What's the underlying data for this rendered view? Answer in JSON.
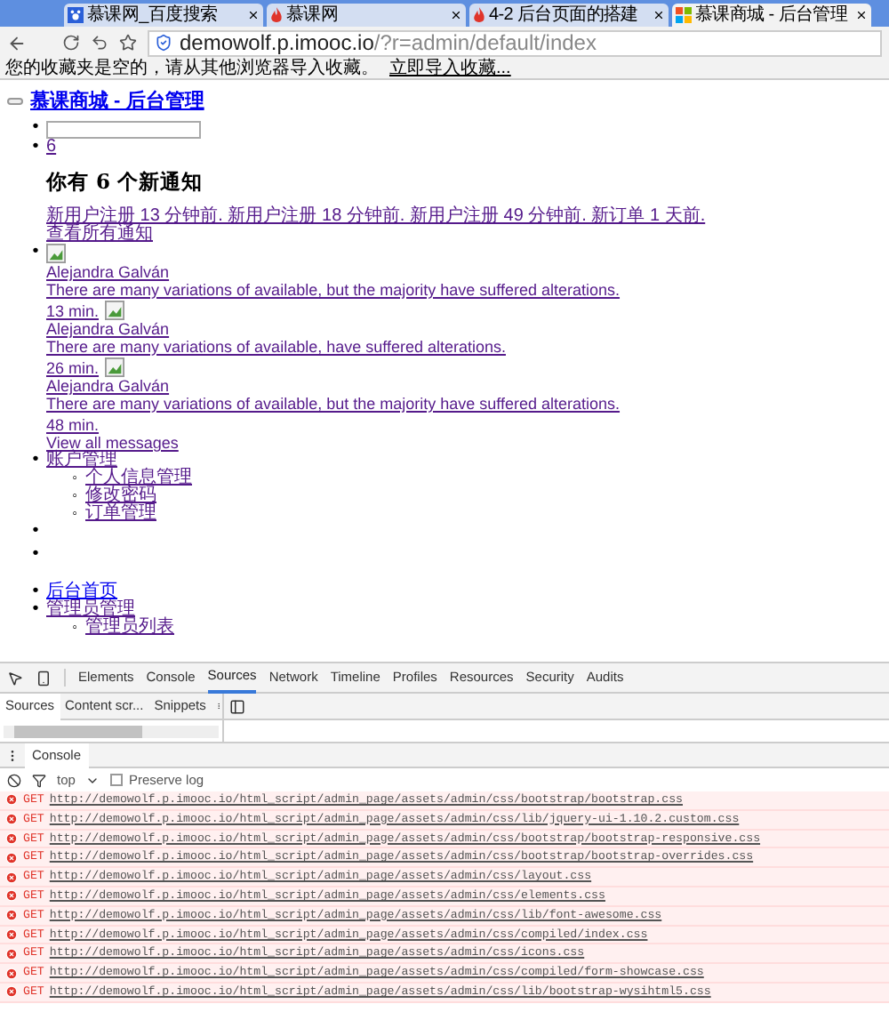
{
  "browser": {
    "tabs": [
      {
        "title": "慕课网_百度搜索",
        "selected": false,
        "kind": "paw"
      },
      {
        "title": "慕课网",
        "selected": false,
        "kind": "flame"
      },
      {
        "title": "4-2 后台页面的搭建",
        "selected": false,
        "kind": "flame"
      },
      {
        "title": "慕课商城 - 后台管理",
        "selected": true,
        "kind": "grid"
      }
    ],
    "address": {
      "host": "demowolf.p.imooc.io",
      "path": "/?r=admin/default/index"
    },
    "bookmarks_bar": {
      "message": "您的收藏夹是空的，请从其他浏览器导入收藏。",
      "link": "立即导入收藏..."
    }
  },
  "page": {
    "brand": "慕课商城 - 后台管理",
    "menu_items": [
      {
        "kind": "search",
        "marker": "•"
      },
      {
        "kind": "notifications",
        "marker": "•",
        "count": "6",
        "heading": "你有 6 个新通知",
        "notifications": "新用户注册 13 分钟前. 新用户注册 18 分钟前. 新用户注册 49 分钟前. 新订单 1 天前.",
        "view_all": "查看所有通知"
      },
      {
        "kind": "messages",
        "marker": "•",
        "messages": [
          {
            "name": "Alejandra Galván",
            "text": "There are many variations of available, but the majority have suffered alterations.",
            "time": "13 min."
          },
          {
            "name": "Alejandra Galván",
            "text": "There are many variations of available, have suffered alterations.",
            "time": "26 min."
          },
          {
            "name": "Alejandra Galván",
            "text": "There are many variations of available, but the majority have suffered alterations.",
            "time": "48 min."
          }
        ],
        "view_all": "View all messages"
      },
      {
        "kind": "menu",
        "marker": "•",
        "label": "账户管理",
        "children": [
          {
            "marker": "◦",
            "label": "个人信息管理"
          },
          {
            "marker": "◦",
            "label": "修改密码"
          },
          {
            "marker": "◦",
            "label": "订单管理"
          }
        ]
      },
      {
        "kind": "empty",
        "marker": "•"
      },
      {
        "kind": "empty",
        "marker": "•"
      }
    ],
    "nav": [
      {
        "marker": "•",
        "label": "后台首页",
        "visited": false
      },
      {
        "marker": "•",
        "label": "管理员管理",
        "visited": true,
        "children": [
          {
            "marker": "◦",
            "label": "管理员列表"
          }
        ]
      }
    ]
  },
  "devtools": {
    "tabs": [
      {
        "label": "Elements",
        "selected": false
      },
      {
        "label": "Console",
        "selected": false
      },
      {
        "label": "Sources",
        "selected": true
      },
      {
        "label": "Network",
        "selected": false
      },
      {
        "label": "Timeline",
        "selected": false
      },
      {
        "label": "Profiles",
        "selected": false
      },
      {
        "label": "Resources",
        "selected": false
      },
      {
        "label": "Security",
        "selected": false
      },
      {
        "label": "Audits",
        "selected": false
      }
    ],
    "sources_tabs": [
      {
        "label": "Sources",
        "selected": true
      },
      {
        "label": "Content scr...",
        "selected": false
      },
      {
        "label": "Snippets",
        "selected": false
      }
    ],
    "drawer_tab": "Console",
    "context": "top",
    "preserve_log": {
      "label": "Preserve log",
      "checked": false
    },
    "log": [
      {
        "method": "GET",
        "url": "http://demowolf.p.imooc.io/html_script/admin_page/assets/admin/css/bootstrap/bootstrap.css"
      },
      {
        "method": "GET",
        "url": "http://demowolf.p.imooc.io/html_script/admin_page/assets/admin/css/lib/jquery-ui-1.10.2.custom.css"
      },
      {
        "method": "GET",
        "url": "http://demowolf.p.imooc.io/html_script/admin_page/assets/admin/css/bootstrap/bootstrap-responsive.css"
      },
      {
        "method": "GET",
        "url": "http://demowolf.p.imooc.io/html_script/admin_page/assets/admin/css/bootstrap/bootstrap-overrides.css"
      },
      {
        "method": "GET",
        "url": "http://demowolf.p.imooc.io/html_script/admin_page/assets/admin/css/layout.css"
      },
      {
        "method": "GET",
        "url": "http://demowolf.p.imooc.io/html_script/admin_page/assets/admin/css/elements.css"
      },
      {
        "method": "GET",
        "url": "http://demowolf.p.imooc.io/html_script/admin_page/assets/admin/css/lib/font-awesome.css"
      },
      {
        "method": "GET",
        "url": "http://demowolf.p.imooc.io/html_script/admin_page/assets/admin/css/compiled/index.css"
      },
      {
        "method": "GET",
        "url": "http://demowolf.p.imooc.io/html_script/admin_page/assets/admin/css/icons.css"
      },
      {
        "method": "GET",
        "url": "http://demowolf.p.imooc.io/html_script/admin_page/assets/admin/css/compiled/form-showcase.css"
      },
      {
        "method": "GET",
        "url": "http://demowolf.p.imooc.io/html_script/admin_page/assets/admin/css/lib/bootstrap-wysihtml5.css"
      }
    ]
  }
}
